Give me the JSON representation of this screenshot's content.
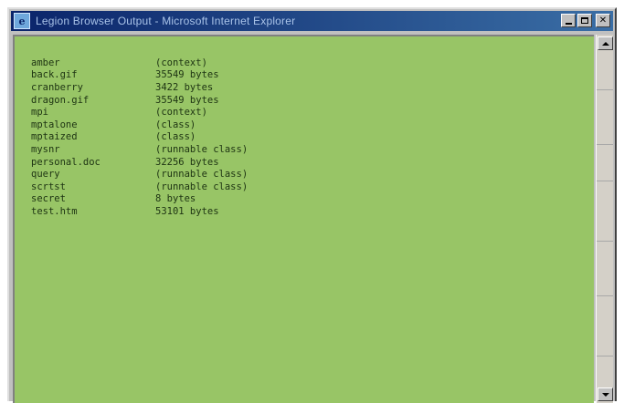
{
  "window": {
    "title": "Legion Browser Output - Microsoft Internet Explorer",
    "icons": {
      "app": "internet-explorer-icon",
      "minimize": "minimize-icon",
      "maximize": "maximize-icon",
      "close": "close-icon"
    },
    "colors": {
      "titlebar": "#0a246a",
      "content_background": "#98c566",
      "text": "#1d3312"
    }
  },
  "listing": [
    {
      "name": "amber",
      "info": "(context)"
    },
    {
      "name": "back.gif",
      "info": "35549 bytes"
    },
    {
      "name": "cranberry",
      "info": "3422 bytes"
    },
    {
      "name": "dragon.gif",
      "info": "35549 bytes"
    },
    {
      "name": "mpi",
      "info": "(context)"
    },
    {
      "name": "mptalone",
      "info": "(class)"
    },
    {
      "name": "mptaized",
      "info": "(class)"
    },
    {
      "name": "mysnr",
      "info": "(runnable class)"
    },
    {
      "name": "personal.doc",
      "info": "32256 bytes"
    },
    {
      "name": "query",
      "info": "(runnable class)"
    },
    {
      "name": "scrtst",
      "info": "(runnable class)"
    },
    {
      "name": "secret",
      "info": "8 bytes"
    },
    {
      "name": "test.htm",
      "info": "53101 bytes"
    }
  ]
}
